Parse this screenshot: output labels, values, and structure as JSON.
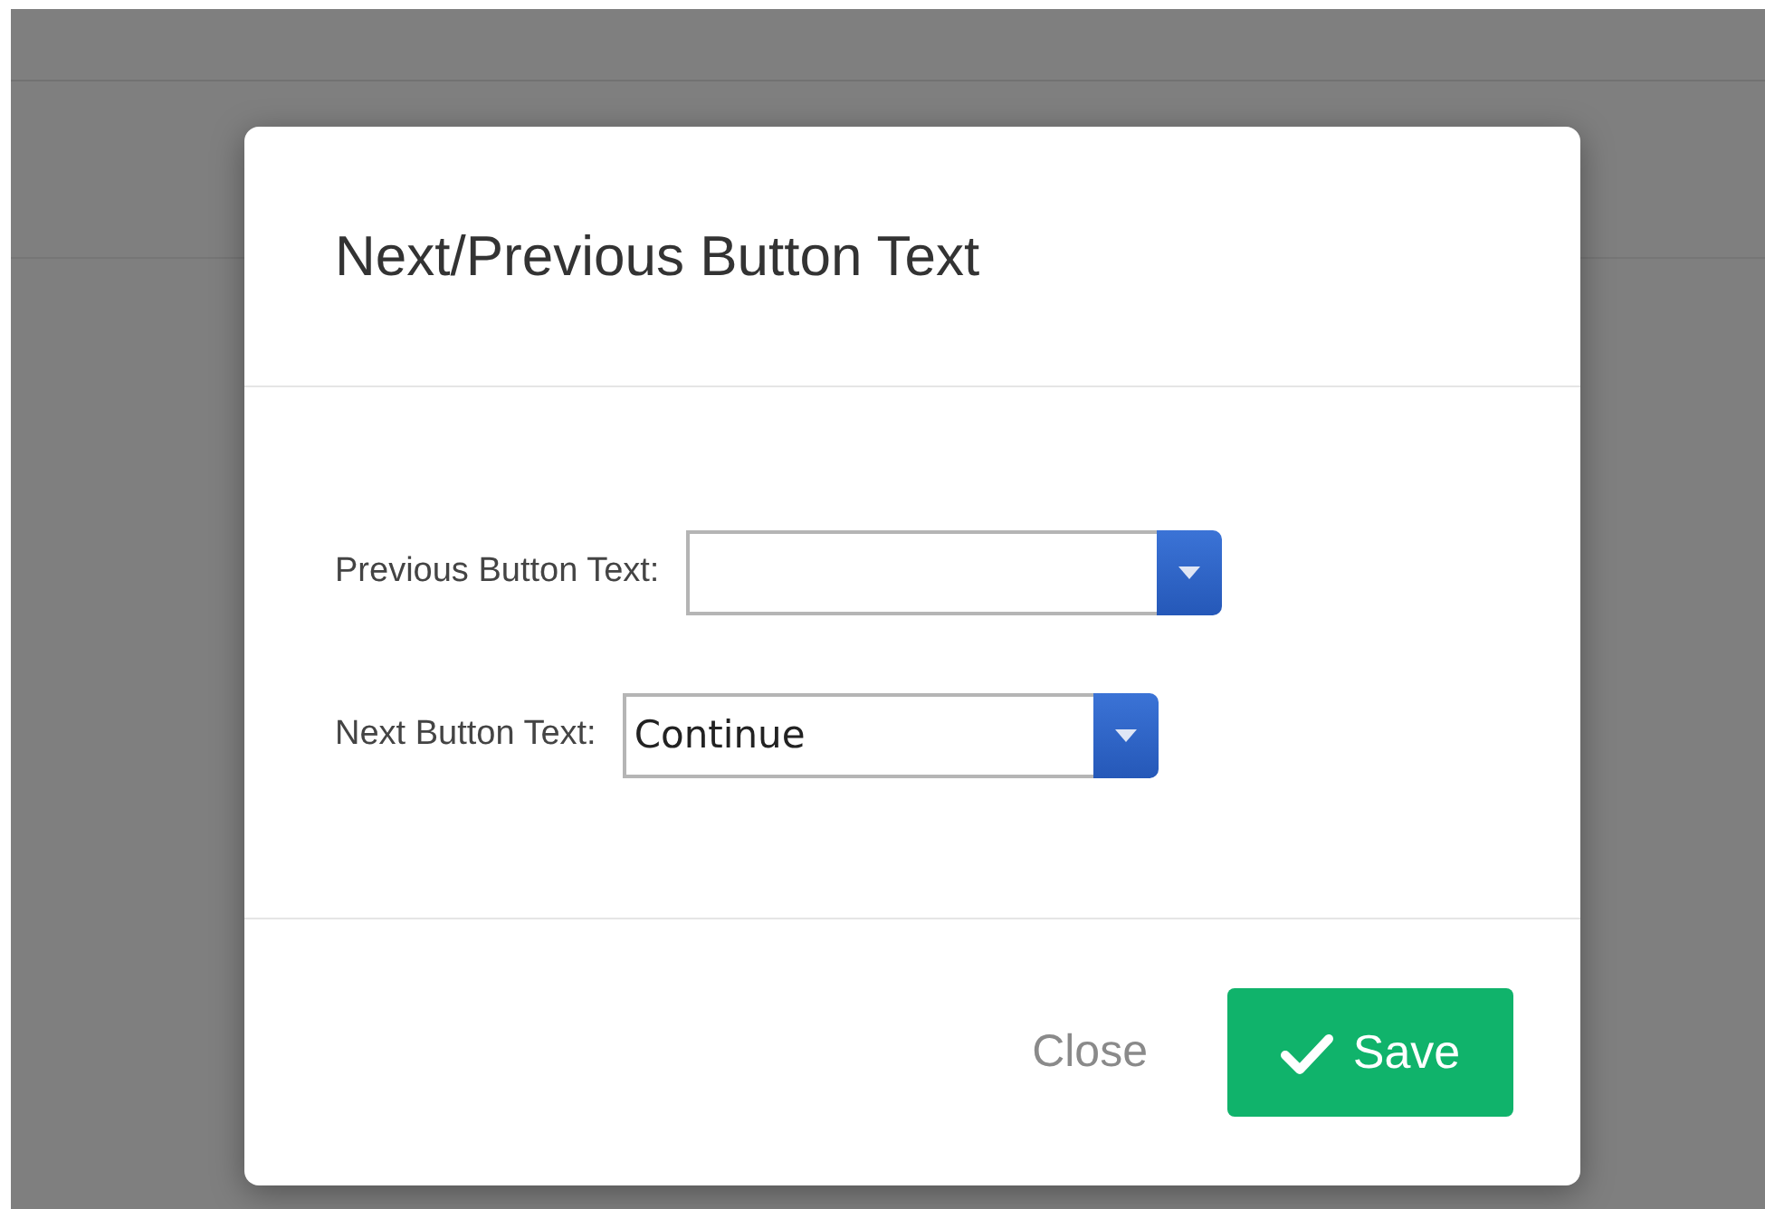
{
  "dialog": {
    "title": "Next/Previous Button Text",
    "fields": [
      {
        "label": "Previous Button Text:"
      },
      {
        "label": "Next Button Text:",
        "value": "Continue"
      }
    ],
    "close_button": {
      "label": "Close"
    },
    "save_button": {
      "label": "Save"
    }
  }
}
